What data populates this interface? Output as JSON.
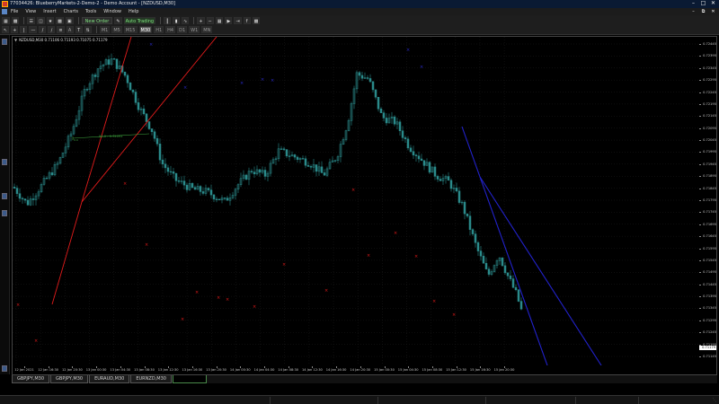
{
  "window": {
    "title": "77034426: BlueberryMarkets-2-Demo-2 - Demo Account - [NZDUSD,M30]"
  },
  "menu": {
    "items": [
      "File",
      "View",
      "Insert",
      "Charts",
      "Tools",
      "Window",
      "Help"
    ]
  },
  "toolbar": {
    "new_order": "New Order",
    "algo_trading": "Auto Trading",
    "timeframes": [
      "M1",
      "M5",
      "M15",
      "M30",
      "H1",
      "H4",
      "D1",
      "W1",
      "MN"
    ],
    "selected_timeframe": "M30"
  },
  "chart": {
    "header": "NZDUSD,M30  0.71106 0.71193 0.71075 0.71179",
    "current_price": "0.71179",
    "colors": {
      "up_candle": "#2a8a8a",
      "down_candle": "#2a8a8a",
      "grid": "#1c1c1c",
      "red_line": "#e21b1b",
      "blue_line": "#2222cc",
      "red_marker": "#e41a1a",
      "blue_marker": "#2a2acc",
      "fib_label": "#3ca03c"
    },
    "price_labels": [
      "0.72445",
      "0.72395",
      "0.72345",
      "0.72295",
      "0.72245",
      "0.72195",
      "0.72145",
      "0.72095",
      "0.72045",
      "0.71995",
      "0.71945",
      "0.71895",
      "0.71845",
      "0.71795",
      "0.71745",
      "0.71695",
      "0.71645",
      "0.71595",
      "0.71545",
      "0.71495",
      "0.71445",
      "0.71395",
      "0.71345",
      "0.71295",
      "0.71245",
      "0.71195",
      "0.71145"
    ],
    "time_labels": [
      "12 Jan 2021",
      "12 Jan 16:30",
      "12 Jan 20:30",
      "13 Jan 00:30",
      "13 Jan 04:30",
      "13 Jan 08:30",
      "13 Jan 12:30",
      "13 Jan 16:30",
      "13 Jan 20:30",
      "14 Jan 00:30",
      "14 Jan 04:30",
      "14 Jan 08:30",
      "14 Jan 12:30",
      "14 Jan 16:30",
      "14 Jan 20:30",
      "15 Jan 00:30",
      "15 Jan 04:30",
      "15 Jan 08:30",
      "15 Jan 12:30",
      "15 Jan 16:30",
      "15 Jan 20:30"
    ],
    "fib_text": "50.0 - 0.72093",
    "fib_text_left": "0.0"
  },
  "tabs": [
    {
      "label": "GBPJPY,M30"
    },
    {
      "label": "GBPJPY,M30"
    },
    {
      "label": "EURAUD,M30"
    },
    {
      "label": "EURNZD,M30"
    }
  ]
}
